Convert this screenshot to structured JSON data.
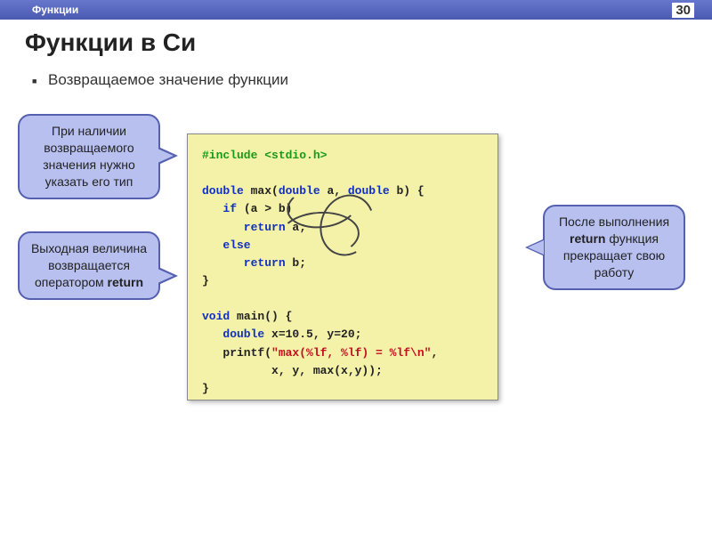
{
  "header": {
    "breadcrumb": "Функции",
    "page_number": "30"
  },
  "title": "Функции в Си",
  "bullet": "Возвращаемое значение функции",
  "callouts": {
    "top_left": "При наличии возвращаемого значения нужно указать его тип",
    "bottom_left_pre": "Выходная величина возвращается оператором ",
    "bottom_left_bold": "return",
    "right_pre": "После выполнения ",
    "right_bold": "return",
    "right_post": " функция прекращает свою работу"
  },
  "code": {
    "l1a": "#include <stdio.h>",
    "l2_t": "double",
    "l2_r": " max(",
    "l2_t2": "double",
    "l2_r2": " a, ",
    "l2_t3": "double",
    "l2_r3": " b) {",
    "l3_k": "   if",
    "l3_r": " (a > b)",
    "l4_k": "      return",
    "l4_r": " a;",
    "l5_k": "   else",
    "l6_k": "      return",
    "l6_r": " b;",
    "l7": "}",
    "l8_t": "void",
    "l8_r": " main() {",
    "l9_t": "   double",
    "l9_r": " x=10.5, y=20;",
    "l10a": "   printf(",
    "l10s": "\"max(%lf, %lf) = %lf\\n\"",
    "l10b": ",",
    "l11": "          x, y, max(x,y));",
    "l12": "}"
  }
}
